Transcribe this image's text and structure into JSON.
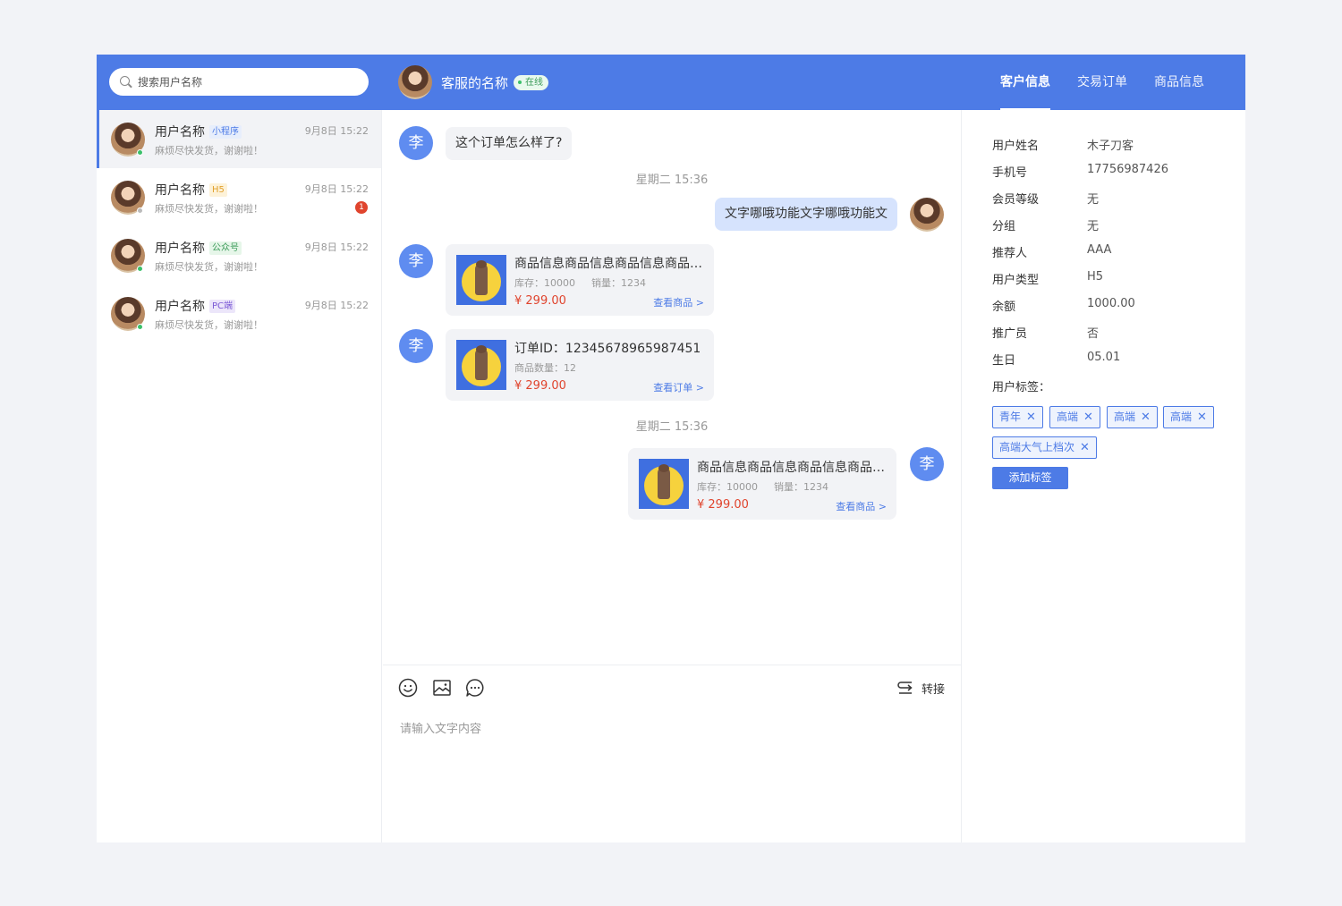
{
  "search": {
    "placeholder": "搜索用户名称"
  },
  "agent": {
    "name": "客服的名称",
    "status": "在线"
  },
  "tabs": [
    {
      "label": "客户信息",
      "active": true
    },
    {
      "label": "交易订单",
      "active": false
    },
    {
      "label": "商品信息",
      "active": false
    }
  ],
  "conversations": [
    {
      "name": "用户名称",
      "source": "小程序",
      "preview": "麻烦尽快发货，谢谢啦！",
      "time": "9月8日 15:22",
      "unread": "",
      "online": true
    },
    {
      "name": "用户名称",
      "source": "H5",
      "preview": "麻烦尽快发货，谢谢啦！",
      "time": "9月8日 15:22",
      "unread": "1",
      "online": false
    },
    {
      "name": "用户名称",
      "source": "公众号",
      "preview": "麻烦尽快发货，谢谢啦！",
      "time": "9月8日 15:22",
      "unread": "",
      "online": true
    },
    {
      "name": "用户名称",
      "source": "PC端",
      "preview": "麻烦尽快发货，谢谢啦！",
      "time": "9月8日 15:22",
      "unread": "",
      "online": true
    }
  ],
  "messages": {
    "user_avatar_char": "李",
    "m1": "这个订单怎么样了?",
    "sep1": "星期二 15:36",
    "m2": "文字哪哦功能文字哪哦功能文",
    "product1": {
      "title": "商品信息商品信息商品信息商品信息商品信息",
      "stock": "库存：10000",
      "sales": "销量：1234",
      "price": "¥ 299.00",
      "link": "查看商品 >"
    },
    "order1": {
      "title": "订单ID：12345678965987451",
      "qty": "商品数量：12",
      "price": "¥ 299.00",
      "link": "查看订单 >"
    },
    "sep2": "星期二 15:36",
    "product2": {
      "title": "商品信息商品信息商品信息商品信息商品信息",
      "stock": "库存：10000",
      "sales": "销量：1234",
      "price": "¥ 299.00",
      "link": "查看商品 >"
    }
  },
  "composer": {
    "transfer_label": "转接",
    "placeholder": "请输入文字内容"
  },
  "customer": {
    "fields": [
      {
        "label": "用户姓名",
        "value": "木子刀客"
      },
      {
        "label": "手机号",
        "value": "17756987426"
      },
      {
        "label": "会员等级",
        "value": "无"
      },
      {
        "label": "分组",
        "value": "无"
      },
      {
        "label": "推荐人",
        "value": "AAA"
      },
      {
        "label": "用户类型",
        "value": "H5"
      },
      {
        "label": "余额",
        "value": "1000.00"
      },
      {
        "label": "推广员",
        "value": "否"
      },
      {
        "label": "生日",
        "value": "05.01"
      }
    ],
    "tags_title": "用户标签：",
    "tags": [
      "青年",
      "高端",
      "高端",
      "高端",
      "高端大气上档次"
    ],
    "add_tag_label": "添加标签"
  },
  "colors": {
    "primary": "#4d7be6",
    "price": "#e0442d",
    "online": "#3bc06a"
  }
}
